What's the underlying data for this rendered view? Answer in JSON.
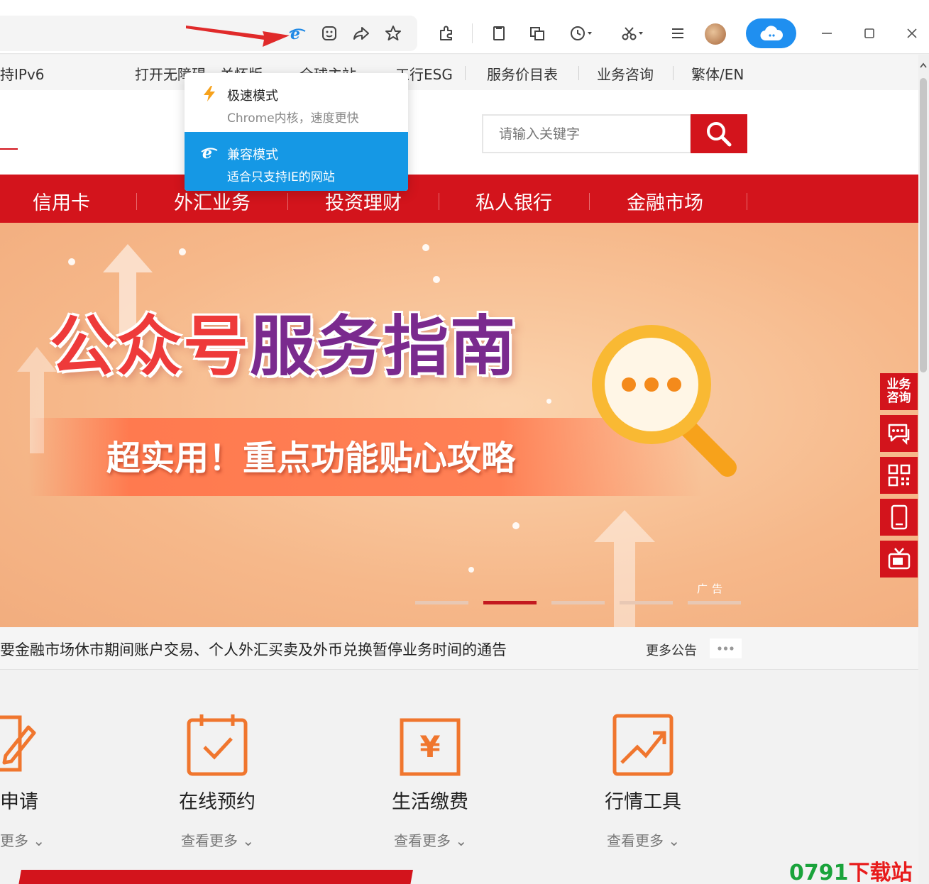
{
  "toolbar": {
    "cloud_label": "cloud"
  },
  "linkbar": {
    "items": [
      "持IPv6",
      "打开无障碍",
      "关怀版",
      "全球主站",
      "工行ESG",
      "服务价目表",
      "业务咨询",
      "繁体/EN"
    ]
  },
  "search": {
    "placeholder": "请输入关键字"
  },
  "nav": {
    "items": [
      "信用卡",
      "外汇业务",
      "投资理财",
      "私人银行",
      "金融市场"
    ]
  },
  "popup": {
    "items": [
      {
        "title": "极速模式",
        "desc": "Chrome内核，速度更快",
        "selected": false
      },
      {
        "title": "兼容模式",
        "desc": "适合只支持IE的网站",
        "selected": true
      }
    ]
  },
  "banner": {
    "title_part1": "公众号",
    "title_part2": "服务指南",
    "subtitle": "超实用！重点功能贴心攻略",
    "ad_label": "广告",
    "active_slide": 2,
    "slide_count": 5
  },
  "side": {
    "consult_label": "业务\n咨询"
  },
  "notice": {
    "text": "要金融市场休市期间账户交易、个人外汇买卖及外币兑换暂停业务时间的通告",
    "more_label": "更多公告"
  },
  "services": {
    "items": [
      {
        "label": "申请",
        "more": "更多"
      },
      {
        "label": "在线预约",
        "more": "查看更多"
      },
      {
        "label": "生活缴费",
        "more": "查看更多"
      },
      {
        "label": "行情工具",
        "more": "查看更多"
      }
    ]
  },
  "watermark": {
    "num": "0791",
    "cn": "下载站"
  },
  "colors": {
    "brand_red": "#d3141c",
    "popup_active": "#1598e5",
    "cloud_blue": "#1f8ff0"
  }
}
